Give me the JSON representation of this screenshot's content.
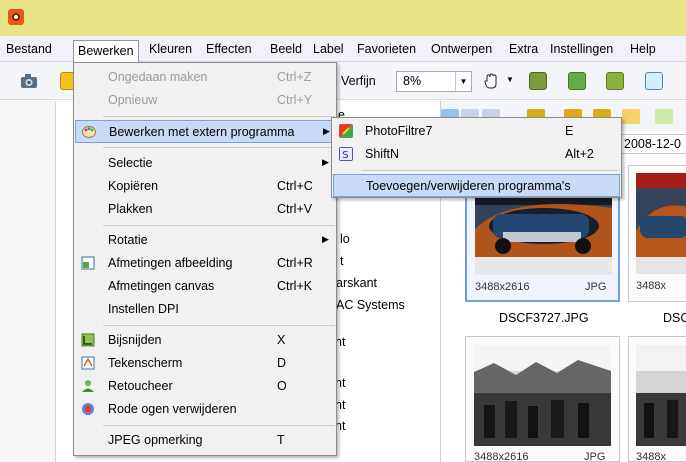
{
  "menu_bar": [
    "Bestand",
    "Bewerken",
    "Kleuren",
    "Effecten",
    "Beeld",
    "Label",
    "Favorieten",
    "Ontwerpen",
    "Extra",
    "Instellingen",
    "Help"
  ],
  "toolbar": {
    "refine_label": "Verfijn",
    "zoom_value": "8%"
  },
  "bewerken_menu": [
    {
      "label": "Ongedaan maken",
      "shortcut": "Ctrl+Z",
      "disabled": true
    },
    {
      "label": "Opnieuw",
      "shortcut": "Ctrl+Y",
      "disabled": true
    },
    {
      "label": "Bewerken met extern programma",
      "submenu": true,
      "highlighted": true
    },
    {
      "label": "Selectie",
      "submenu": true
    },
    {
      "label": "Kopiëren",
      "shortcut": "Ctrl+C"
    },
    {
      "label": "Plakken",
      "shortcut": "Ctrl+V"
    },
    {
      "label": "Rotatie",
      "submenu": true
    },
    {
      "label": "Afmetingen afbeelding",
      "shortcut": "Ctrl+R"
    },
    {
      "label": "Afmetingen canvas",
      "shortcut": "Ctrl+K"
    },
    {
      "label": "Instellen DPI"
    },
    {
      "label": "Bijsnijden",
      "shortcut": "X"
    },
    {
      "label": "Tekenscherm",
      "shortcut": "D"
    },
    {
      "label": "Retoucheer",
      "shortcut": "O"
    },
    {
      "label": "Rode ogen verwijderen"
    },
    {
      "label": "JPEG opmerking",
      "shortcut": "T"
    }
  ],
  "external_submenu": [
    {
      "label": "PhotoFiltre7",
      "shortcut": "E"
    },
    {
      "label": "ShiftN",
      "shortcut": "Alt+2"
    },
    {
      "label": "Toevoegen/verwijderen programma's",
      "highlighted": true
    }
  ],
  "tree_fragments": [
    "e",
    "lo",
    "t",
    "arskant",
    "AC Systems",
    "nt",
    "nt",
    "nt",
    "nt"
  ],
  "thumbnail_panel": {
    "date_tab": "2008-12-0",
    "thumbs": [
      {
        "dimensions": "3488x2616",
        "format": "JPG",
        "filename": "DSCF3727.JPG"
      },
      {
        "dimensions": "3488x",
        "format": "",
        "filename": "DSC"
      },
      {
        "dimensions": "3488x2616",
        "format": "JPG",
        "filename": ""
      },
      {
        "dimensions": "3488x",
        "format": "",
        "filename": ""
      }
    ]
  },
  "colors": {
    "title_bar": "#e8e488",
    "menu_highlight": "#c7daf7",
    "selected_border": "#6f9fdf"
  }
}
